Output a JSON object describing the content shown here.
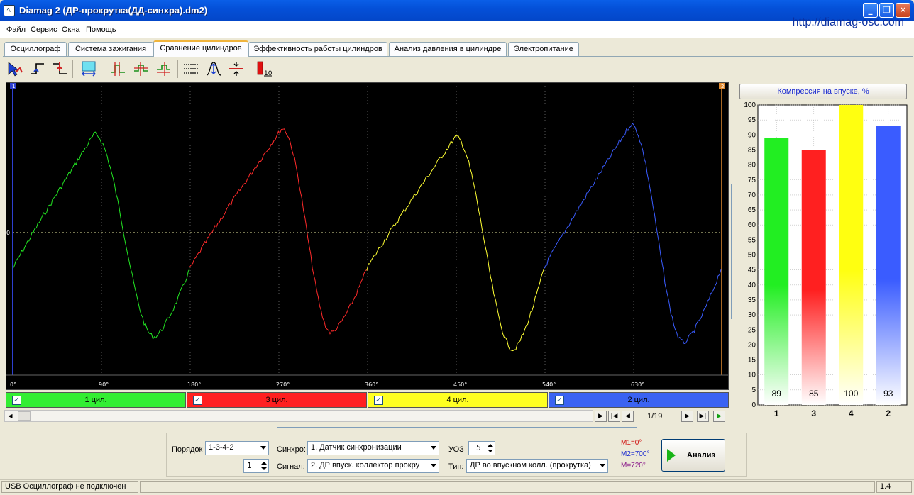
{
  "window": {
    "title": "Diamag 2 (ДР-прокрутка(ДД-синхра).dm2)",
    "url": "http://diamag-osc.com"
  },
  "menu": [
    "Файл",
    "Сервис",
    "Окна",
    "Помощь"
  ],
  "tabs": [
    {
      "label": "Осциллограф",
      "active": false
    },
    {
      "label": "Система зажигания",
      "active": false
    },
    {
      "label": "Сравнение цилиндров",
      "active": true
    },
    {
      "label": "Эффективность работы цилиндров",
      "active": false
    },
    {
      "label": "Анализ давления в цилиндре",
      "active": false
    },
    {
      "label": "Электропитание",
      "active": false
    }
  ],
  "toolbar": {
    "icons": [
      "cursor-select-icon",
      "rising-edge-icon",
      "falling-edge-icon",
      "stretch-icon",
      "marker-1-icon",
      "marker-2-icon",
      "marker-3-icon",
      "grid-lines-icon",
      "vertical-scale-icon",
      "offset-icon",
      "bar-10-icon"
    ],
    "bar_label": "10"
  },
  "scope": {
    "zero_label": "0",
    "marker_left": "1",
    "marker_right": "2",
    "x_ticks": [
      "0°",
      "90°",
      "180°",
      "270°",
      "360°",
      "450°",
      "540°",
      "630°"
    ],
    "trace_colors": [
      "#22e622",
      "#ff2a2a",
      "#ffff33",
      "#3a5cff"
    ]
  },
  "cylinders": [
    {
      "label": "1 цил.",
      "color": "#33ee33",
      "checked": true
    },
    {
      "label": "3 цил.",
      "color": "#ff2020",
      "checked": true
    },
    {
      "label": "4 цил.",
      "color": "#ffff22",
      "checked": true
    },
    {
      "label": "2 цил.",
      "color": "#3b63f2",
      "checked": true
    }
  ],
  "navigation": {
    "page": "1/19"
  },
  "controls": {
    "order_label": "Порядок",
    "order_value": "1-3-4-2",
    "order_spin": "1",
    "sync_label": "Синхро:",
    "sync_value": "1.  Датчик синхронизации",
    "signal_label": "Сигнал:",
    "signal_value": "2.  ДР впуск. коллектор прокру",
    "uoz_label": "УОЗ",
    "uoz_value": "5",
    "type_label": "Тип:",
    "type_value": "ДР во впускном колл. (прокрутка)",
    "m1": "M1=0°",
    "m2": "M2=700°",
    "m": "M=720°",
    "analyze_label": "Анализ"
  },
  "chart_data": {
    "type": "bar",
    "title": "Компрессия на впуске, %",
    "categories": [
      "1",
      "3",
      "4",
      "2"
    ],
    "values": [
      89,
      85,
      100,
      93
    ],
    "colors": [
      "#22ee22",
      "#ff2020",
      "#ffff10",
      "#3a5cff"
    ],
    "ylim": [
      0,
      100
    ],
    "yticks": [
      "0",
      "5",
      "10",
      "15",
      "20",
      "25",
      "30",
      "35",
      "40",
      "45",
      "50",
      "55",
      "60",
      "65",
      "70",
      "75",
      "80",
      "85",
      "90",
      "95",
      "100"
    ],
    "grid": true,
    "legend": "none"
  },
  "status": {
    "usb": "USB Осциллограф не подключен",
    "version": "1.4"
  }
}
